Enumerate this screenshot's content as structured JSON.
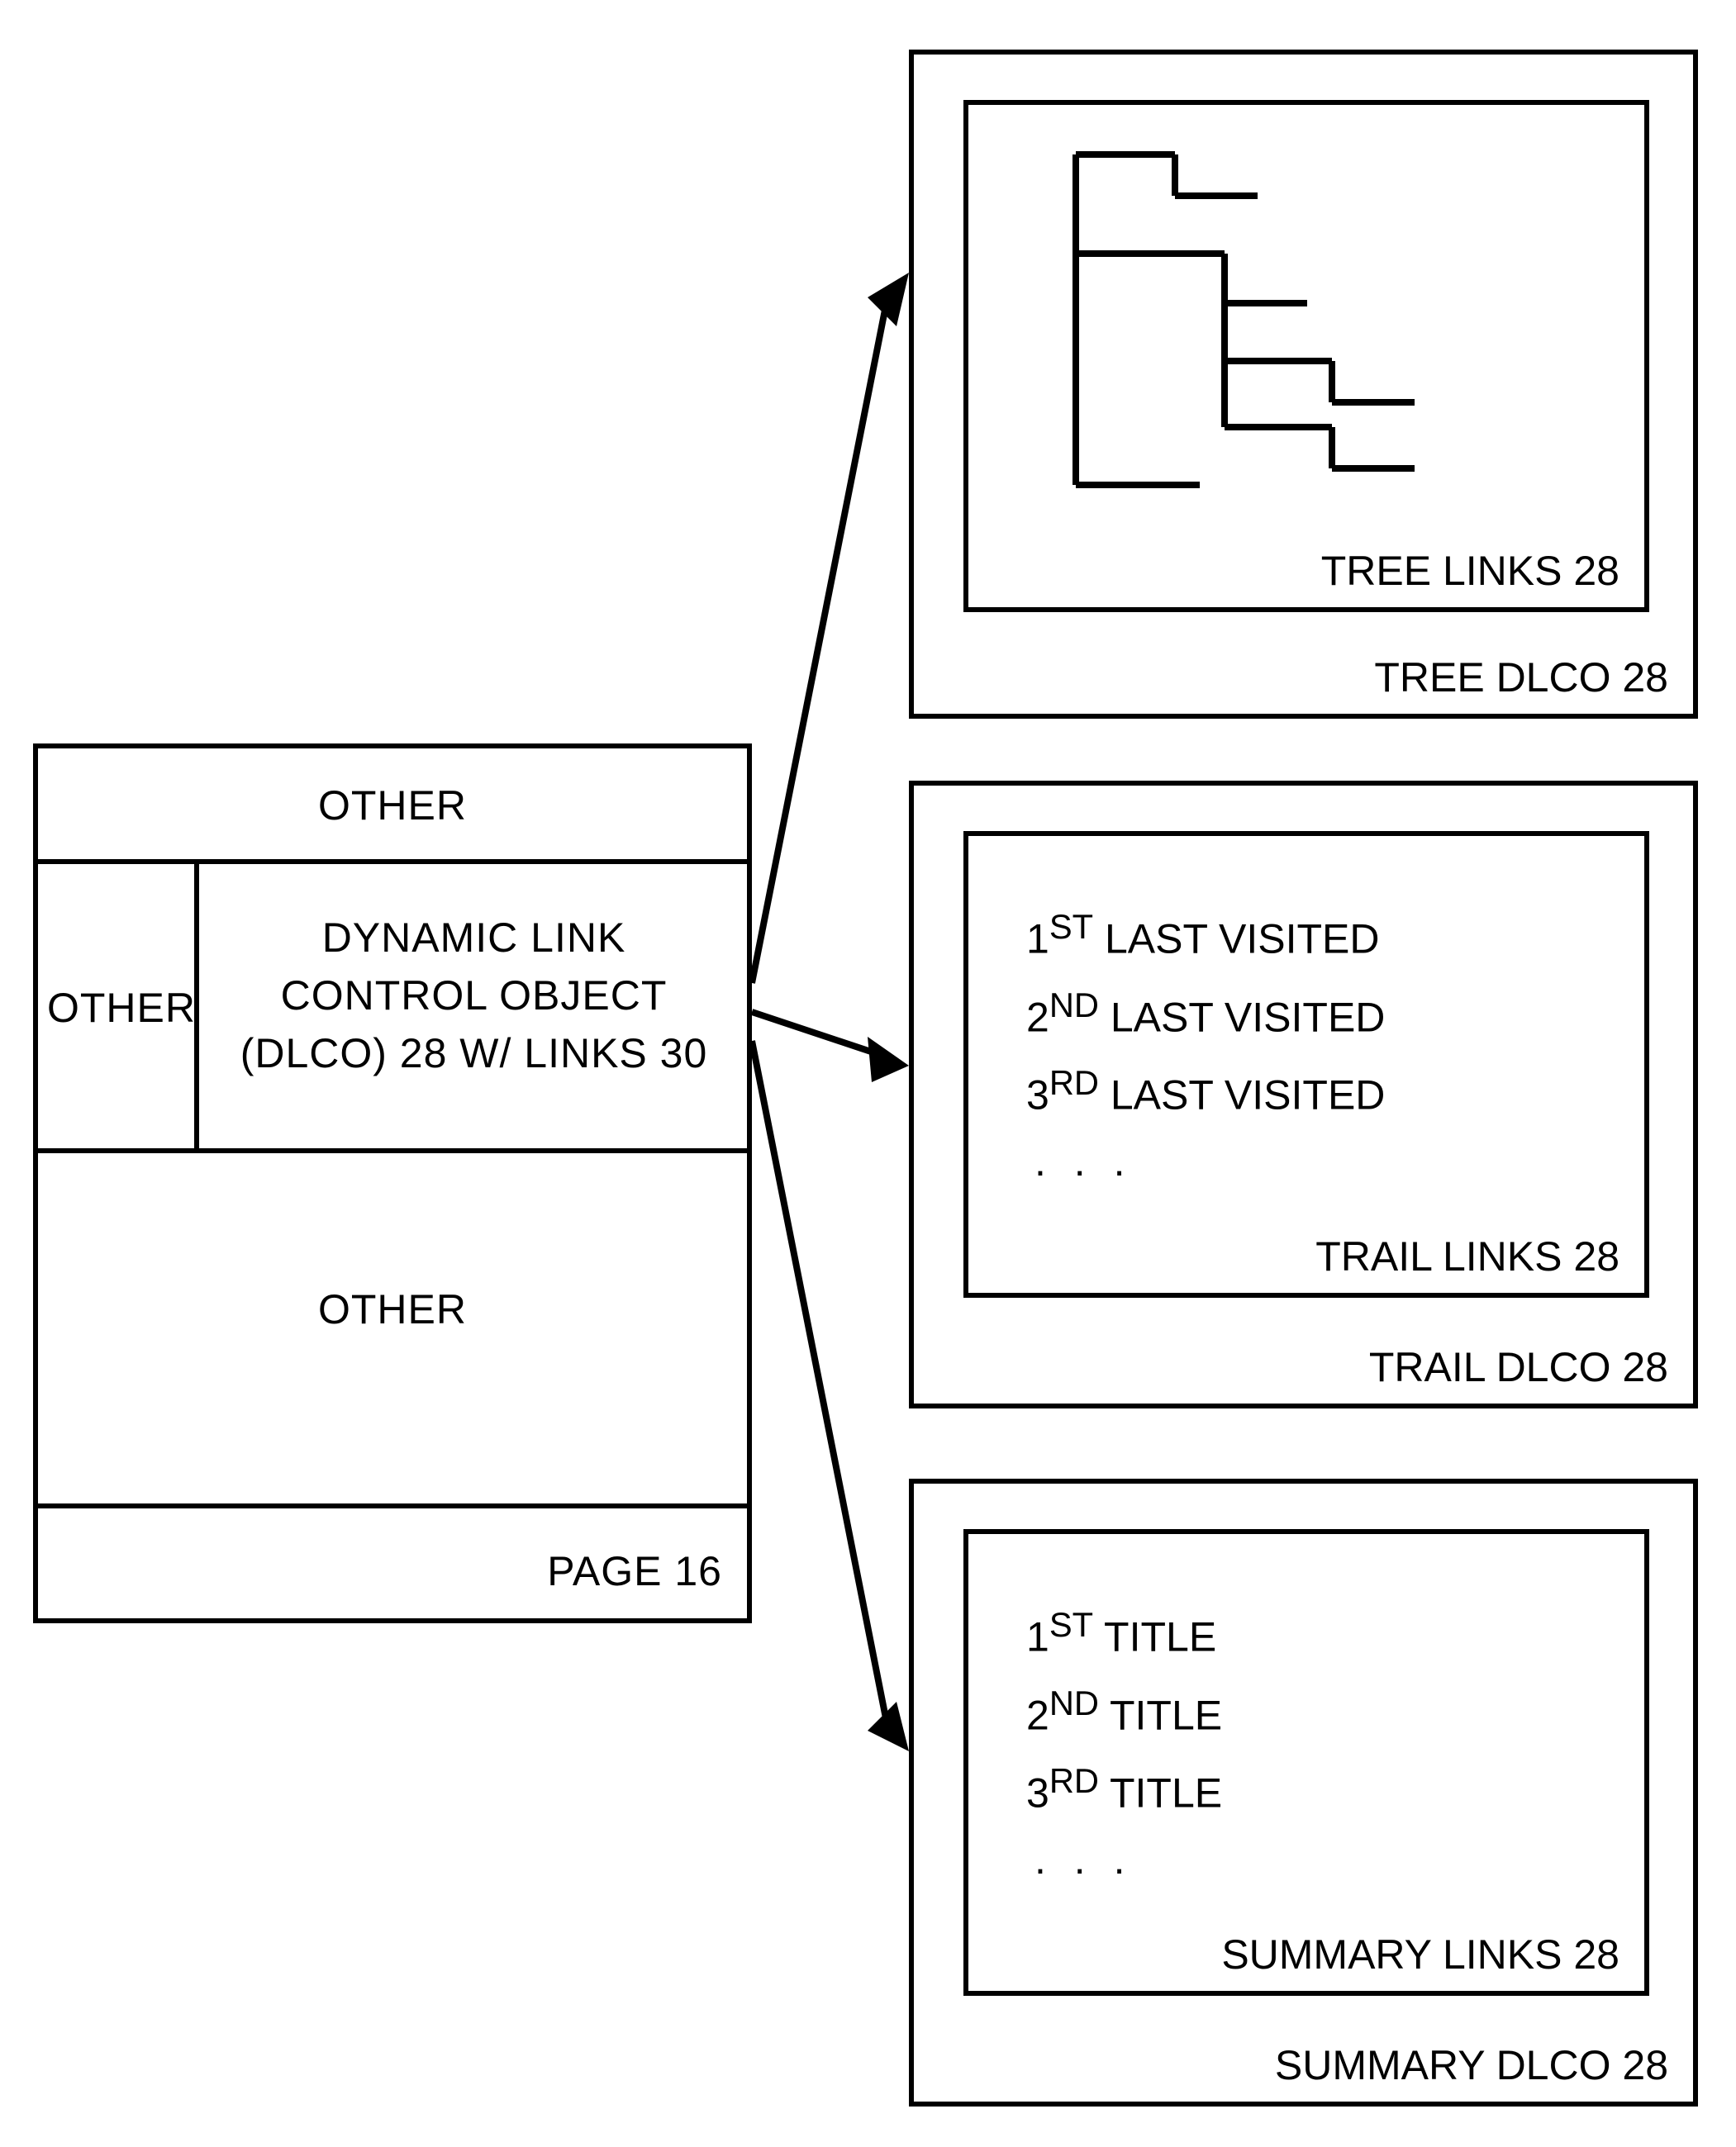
{
  "page": {
    "top_label": "OTHER",
    "left_label": "OTHER",
    "dlco_label_line1": "DYNAMIC LINK",
    "dlco_label_line2": "CONTROL OBJECT",
    "dlco_label_line3": "(DLCO) 28 W/ LINKS 30",
    "bottom_other": "OTHER",
    "page_caption": "PAGE 16"
  },
  "tree": {
    "links_caption": "TREE LINKS  28",
    "dlco_caption": "TREE DLCO  28"
  },
  "trail": {
    "lines": [
      "1ST LAST VISITED",
      "2ND LAST VISITED",
      "3RD LAST VISITED"
    ],
    "dots": ". . .",
    "links_caption": "TRAIL LINKS  28",
    "dlco_caption": "TRAIL DLCO  28"
  },
  "summary": {
    "lines": [
      "1ST TITLE",
      "2ND TITLE",
      "3RD TITLE"
    ],
    "dots": ". . .",
    "links_caption": "SUMMARY LINKS  28",
    "dlco_caption": "SUMMARY DLCO  28"
  }
}
